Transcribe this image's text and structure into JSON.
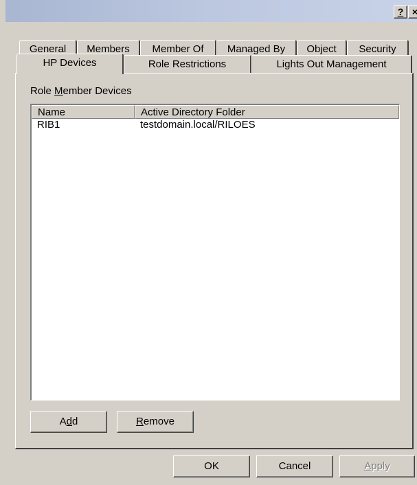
{
  "titlebar": {
    "help_label": "?",
    "close_label": "×"
  },
  "tabs_back": [
    {
      "label": "General"
    },
    {
      "label": "Members"
    },
    {
      "label": "Member Of"
    },
    {
      "label": "Managed By"
    },
    {
      "label": "Object"
    },
    {
      "label": "Security"
    }
  ],
  "tabs_front": [
    {
      "label": "HP Devices",
      "active": true
    },
    {
      "label": "Role Restrictions"
    },
    {
      "label": "Lights Out Management"
    }
  ],
  "group": {
    "label_pre": "Role ",
    "label_mnemonic": "M",
    "label_post": "ember Devices"
  },
  "list": {
    "columns": [
      "Name",
      "Active Directory Folder"
    ],
    "rows": [
      {
        "name": "RIB1",
        "folder": "testdomain.local/RILOES"
      }
    ]
  },
  "buttons": {
    "add": {
      "pre": "A",
      "mnemonic": "d",
      "post": "d"
    },
    "remove": {
      "pre": "",
      "mnemonic": "R",
      "post": "emove"
    },
    "ok": "OK",
    "cancel": "Cancel",
    "apply": {
      "pre": "",
      "mnemonic": "A",
      "post": "pply"
    }
  }
}
